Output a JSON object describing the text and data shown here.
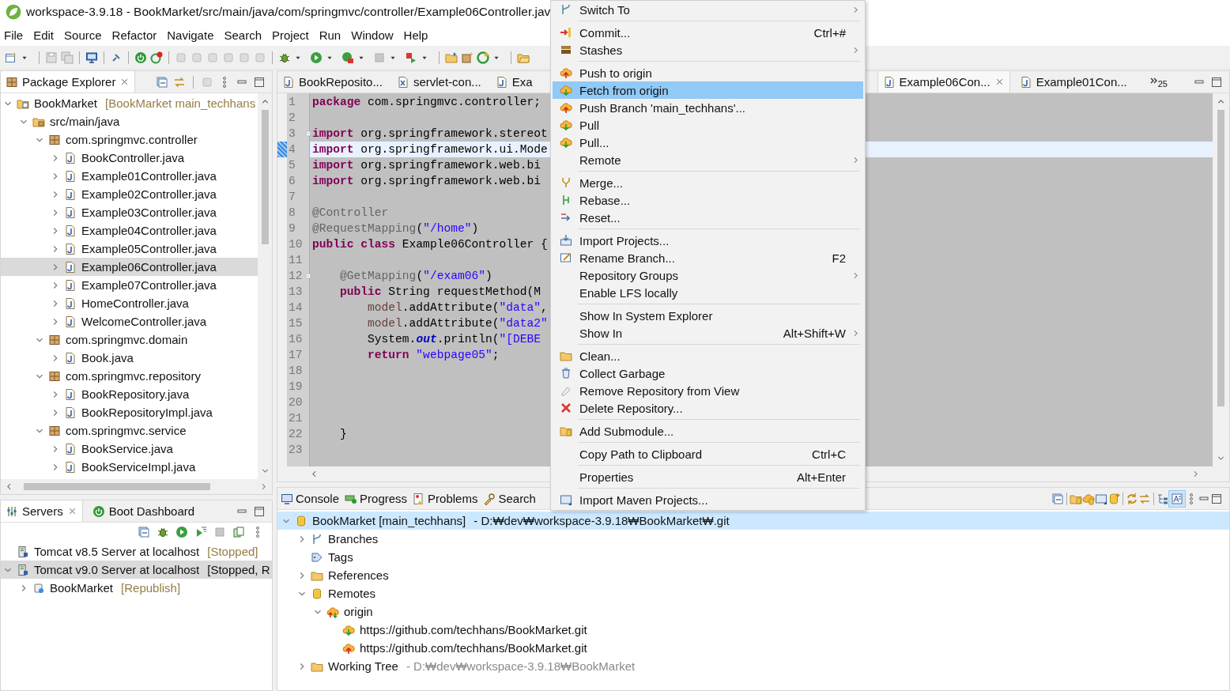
{
  "window": {
    "title": "workspace-3.9.18 - BookMarket/src/main/java/com/springmvc/controller/Example06Controller.jav"
  },
  "menu_bar": [
    "File",
    "Edit",
    "Source",
    "Refactor",
    "Navigate",
    "Search",
    "Project",
    "Run",
    "Window",
    "Help"
  ],
  "package_explorer": {
    "tab": {
      "label": "Package Explorer",
      "selected": true
    },
    "tree": [
      {
        "label": "BookMarket",
        "decoration": "[BookMarket main_techhans",
        "kind": "project",
        "expanded": true,
        "selected": false,
        "children": [
          {
            "label": "src/main/java",
            "kind": "srcfolder",
            "expanded": true,
            "selected": false,
            "children": [
              {
                "label": "com.springmvc.controller",
                "kind": "package",
                "expanded": true,
                "selected": false,
                "children": [
                  {
                    "label": "BookController.java",
                    "kind": "java",
                    "expanded": false,
                    "selected": false
                  },
                  {
                    "label": "Example01Controller.java",
                    "kind": "java",
                    "expanded": false,
                    "selected": false
                  },
                  {
                    "label": "Example02Controller.java",
                    "kind": "java",
                    "expanded": false,
                    "selected": false
                  },
                  {
                    "label": "Example03Controller.java",
                    "kind": "java",
                    "expanded": false,
                    "selected": false
                  },
                  {
                    "label": "Example04Controller.java",
                    "kind": "java",
                    "expanded": false,
                    "selected": false
                  },
                  {
                    "label": "Example05Controller.java",
                    "kind": "java",
                    "expanded": false,
                    "selected": false
                  },
                  {
                    "label": "Example06Controller.java",
                    "kind": "java",
                    "expanded": false,
                    "selected": true
                  },
                  {
                    "label": "Example07Controller.java",
                    "kind": "java",
                    "expanded": false,
                    "selected": false
                  },
                  {
                    "label": "HomeController.java",
                    "kind": "java",
                    "expanded": false,
                    "selected": false
                  },
                  {
                    "label": "WelcomeController.java",
                    "kind": "java",
                    "expanded": false,
                    "selected": false
                  }
                ]
              },
              {
                "label": "com.springmvc.domain",
                "kind": "package",
                "expanded": true,
                "selected": false,
                "children": [
                  {
                    "label": "Book.java",
                    "kind": "java",
                    "expanded": false,
                    "selected": false
                  }
                ]
              },
              {
                "label": "com.springmvc.repository",
                "kind": "package",
                "expanded": true,
                "selected": false,
                "children": [
                  {
                    "label": "BookRepository.java",
                    "kind": "java",
                    "expanded": false,
                    "selected": false
                  },
                  {
                    "label": "BookRepositoryImpl.java",
                    "kind": "java",
                    "expanded": false,
                    "selected": false
                  }
                ]
              },
              {
                "label": "com.springmvc.service",
                "kind": "package",
                "expanded": true,
                "selected": false,
                "children": [
                  {
                    "label": "BookService.java",
                    "kind": "java",
                    "expanded": false,
                    "selected": false
                  },
                  {
                    "label": "BookServiceImpl.java",
                    "kind": "java",
                    "expanded": false,
                    "selected": false
                  }
                ]
              }
            ]
          }
        ]
      }
    ]
  },
  "servers_panel": {
    "tabs": [
      {
        "label": "Servers",
        "kind": "servers",
        "selected": true,
        "closable": true
      },
      {
        "label": "Boot Dashboard",
        "kind": "boot",
        "selected": false,
        "closable": false
      }
    ],
    "tree": [
      {
        "label": "Tomcat v8.5 Server at localhost",
        "decoration": "[Stopped]",
        "kind": "server",
        "selected": false
      },
      {
        "label": "Tomcat v9.0 Server at localhost",
        "decoration": "[Stopped, R",
        "kind": "server",
        "expanded": true,
        "selected": true,
        "children": [
          {
            "label": "BookMarket",
            "decoration": "[Republish]",
            "kind": "module",
            "expanded": false,
            "selected": false
          }
        ]
      }
    ]
  },
  "editor": {
    "tabs_left": [
      {
        "label": "BookReposito...",
        "kind": "java",
        "selected": false
      },
      {
        "label": "servlet-con...",
        "kind": "xml",
        "selected": false
      },
      {
        "label": "Exa",
        "kind": "java",
        "selected": false
      }
    ],
    "tabs_right": [
      {
        "label": "Example06Con...",
        "kind": "java",
        "selected": true
      },
      {
        "label": "Example01Con...",
        "kind": "java",
        "selected": false
      }
    ],
    "more_tabs_count": "25",
    "lines": [
      {
        "number": "1",
        "segments": [
          {
            "kind": "keyword",
            "text": "package"
          },
          {
            "kind": "plain",
            "text": " com.springmvc.controller;"
          }
        ]
      },
      {
        "number": "2"
      },
      {
        "number": "3",
        "foldable": true,
        "segments": [
          {
            "kind": "keyword",
            "text": "import"
          },
          {
            "kind": "plain",
            "text": " org.springframework.stereot"
          }
        ]
      },
      {
        "number": "4",
        "current": true,
        "segments": [
          {
            "kind": "keyword",
            "text": "import"
          },
          {
            "kind": "plain",
            "text": " org.springframework.ui.Mode"
          }
        ]
      },
      {
        "number": "5",
        "segments": [
          {
            "kind": "keyword",
            "text": "import"
          },
          {
            "kind": "plain",
            "text": " org.springframework.web.bi"
          }
        ]
      },
      {
        "number": "6",
        "segments": [
          {
            "kind": "keyword",
            "text": "import"
          },
          {
            "kind": "plain",
            "text": " org.springframework.web.bi"
          }
        ]
      },
      {
        "number": "7"
      },
      {
        "number": "8",
        "segments": [
          {
            "kind": "annotation",
            "text": "@Controller"
          }
        ]
      },
      {
        "number": "9",
        "segments": [
          {
            "kind": "annotation",
            "text": "@RequestMapping"
          },
          {
            "kind": "plain",
            "text": "("
          },
          {
            "kind": "string",
            "text": "\"/home\""
          },
          {
            "kind": "plain",
            "text": ")"
          }
        ]
      },
      {
        "number": "10",
        "segments": [
          {
            "kind": "keyword",
            "text": "public"
          },
          {
            "kind": "keyword",
            "text": " class"
          },
          {
            "kind": "plain",
            "text": " Example06Controller {"
          }
        ]
      },
      {
        "number": "11"
      },
      {
        "number": "12",
        "foldable": true,
        "segments": [
          {
            "kind": "annotation",
            "text": "    @GetMapping"
          },
          {
            "kind": "plain",
            "text": "("
          },
          {
            "kind": "string",
            "text": "\"/exam06\""
          },
          {
            "kind": "plain",
            "text": ")"
          }
        ]
      },
      {
        "number": "13",
        "segments": [
          {
            "kind": "keyword",
            "text": "    public"
          },
          {
            "kind": "plain",
            "text": " String requestMethod(M"
          }
        ]
      },
      {
        "number": "14",
        "segments": [
          {
            "kind": "local",
            "text": "        model"
          },
          {
            "kind": "plain",
            "text": ".addAttribute("
          },
          {
            "kind": "string",
            "text": "\"data\""
          },
          {
            "kind": "plain",
            "text": ","
          }
        ]
      },
      {
        "number": "15",
        "segments": [
          {
            "kind": "local",
            "text": "        model"
          },
          {
            "kind": "plain",
            "text": ".addAttribute("
          },
          {
            "kind": "string",
            "text": "\"data2\""
          }
        ]
      },
      {
        "number": "16",
        "segments": [
          {
            "kind": "plain",
            "text": "        System."
          },
          {
            "kind": "field",
            "text": "out"
          },
          {
            "kind": "plain",
            "text": ".println("
          },
          {
            "kind": "string",
            "text": "\"[DEBE"
          }
        ]
      },
      {
        "number": "17",
        "segments": [
          {
            "kind": "keyword",
            "text": "        return"
          },
          {
            "kind": "string",
            "text": " \"webpage05\""
          },
          {
            "kind": "plain",
            "text": ";"
          }
        ]
      },
      {
        "number": "18"
      },
      {
        "number": "19"
      },
      {
        "number": "20"
      },
      {
        "number": "21"
      },
      {
        "number": "22",
        "segments": [
          {
            "kind": "plain",
            "text": "    }"
          }
        ]
      },
      {
        "number": "23"
      }
    ]
  },
  "bottom_panel": {
    "tabs": [
      {
        "label": "Console",
        "kind": "console",
        "selected": false
      },
      {
        "label": "Progress",
        "kind": "progress",
        "selected": false
      },
      {
        "label": "Problems",
        "kind": "problems",
        "selected": false
      },
      {
        "label": "Search",
        "kind": "search",
        "selected": false
      }
    ],
    "tree": [
      {
        "label": "BookMarket [main_techhans]",
        "decoration": "- D:₩dev₩workspace-3.9.18₩BookMarket₩.git",
        "kind": "repo",
        "expanded": true,
        "selected": true,
        "children": [
          {
            "label": "Branches",
            "kind": "branches",
            "expanded": false,
            "selected": false
          },
          {
            "label": "Tags",
            "kind": "tags",
            "selected": false
          },
          {
            "label": "References",
            "kind": "folder",
            "expanded": false,
            "selected": false
          },
          {
            "label": "Remotes",
            "kind": "remotes",
            "expanded": true,
            "selected": false,
            "children": [
              {
                "label": "origin",
                "kind": "remote",
                "expanded": true,
                "selected": false,
                "children": [
                  {
                    "label": "https://github.com/techhans/BookMarket.git",
                    "kind": "fetch",
                    "selected": false
                  },
                  {
                    "label": "https://github.com/techhans/BookMarket.git",
                    "kind": "push",
                    "selected": false
                  }
                ]
              }
            ]
          },
          {
            "label": "Working Tree",
            "decoration": "- D:₩dev₩workspace-3.9.18₩BookMarket",
            "kind": "folder",
            "expanded": false,
            "selected": false
          }
        ]
      }
    ]
  },
  "context_menu": {
    "groups": [
      [
        {
          "label": "Switch To",
          "submenu": true,
          "selected": false
        }
      ],
      [
        {
          "label": "Commit...",
          "shortcut": "Ctrl+#",
          "submenu": false,
          "selected": false
        },
        {
          "label": "Stashes",
          "submenu": true,
          "selected": false
        }
      ],
      [
        {
          "label": "Push to origin",
          "submenu": false,
          "selected": false
        },
        {
          "label": "Fetch from origin",
          "submenu": false,
          "selected": true
        },
        {
          "label": "Push Branch 'main_techhans'...",
          "submenu": false,
          "selected": false
        },
        {
          "label": "Pull",
          "submenu": false,
          "selected": false
        },
        {
          "label": "Pull...",
          "submenu": false,
          "selected": false
        },
        {
          "label": "Remote",
          "submenu": true,
          "selected": false
        }
      ],
      [
        {
          "label": "Merge...",
          "submenu": false,
          "selected": false
        },
        {
          "label": "Rebase...",
          "submenu": false,
          "selected": false
        },
        {
          "label": "Reset...",
          "submenu": false,
          "selected": false
        }
      ],
      [
        {
          "label": "Import Projects...",
          "submenu": false,
          "selected": false
        },
        {
          "label": "Rename Branch...",
          "shortcut": "F2",
          "submenu": false,
          "selected": false
        },
        {
          "label": "Repository Groups",
          "submenu": true,
          "selected": false
        },
        {
          "label": "Enable LFS locally",
          "submenu": false,
          "selected": false
        }
      ],
      [
        {
          "label": "Show In System Explorer",
          "submenu": false,
          "selected": false
        },
        {
          "label": "Show In",
          "shortcut": "Alt+Shift+W",
          "submenu": true,
          "selected": false
        }
      ],
      [
        {
          "label": "Clean...",
          "submenu": false,
          "selected": false
        },
        {
          "label": "Collect Garbage",
          "submenu": false,
          "selected": false
        },
        {
          "label": "Remove Repository from View",
          "submenu": false,
          "selected": false
        },
        {
          "label": "Delete Repository...",
          "submenu": false,
          "selected": false
        }
      ],
      [
        {
          "label": "Add Submodule...",
          "submenu": false,
          "selected": false
        }
      ],
      [
        {
          "label": "Copy Path to Clipboard",
          "shortcut": "Ctrl+C",
          "submenu": false,
          "selected": false
        }
      ],
      [
        {
          "label": "Properties",
          "shortcut": "Alt+Enter",
          "submenu": false,
          "selected": false
        }
      ],
      [
        {
          "label": "Import Maven Projects...",
          "submenu": false,
          "selected": false
        }
      ]
    ]
  }
}
